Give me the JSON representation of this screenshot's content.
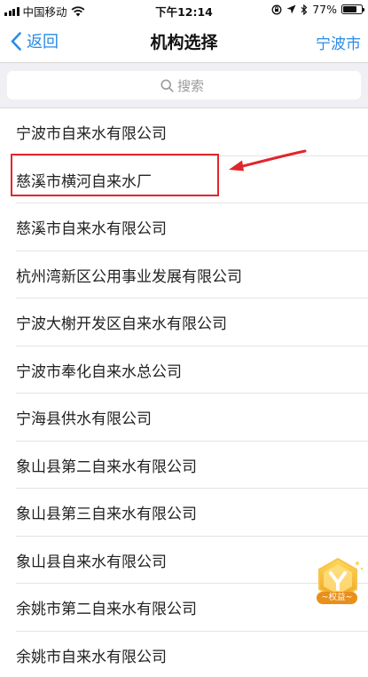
{
  "status_bar": {
    "carrier": "中国移动",
    "time": "下午12:14",
    "battery": "77%",
    "battery_level": 0.77
  },
  "nav": {
    "back_label": "返回",
    "title": "机构选择",
    "city": "宁波市"
  },
  "search": {
    "placeholder": "搜索"
  },
  "organizations": [
    "宁波市自来水有限公司",
    "慈溪市横河自来水厂",
    "慈溪市自来水有限公司",
    "杭州湾新区公用事业发展有限公司",
    "宁波大榭开发区自来水有限公司",
    "宁波市奉化自来水总公司",
    "宁海县供水有限公司",
    "象山县第二自来水有限公司",
    "象山县第三自来水有限公司",
    "象山县自来水有限公司",
    "余姚市第二自来水有限公司",
    "余姚市自来水有限公司"
  ],
  "highlighted_index": 1,
  "badge": {
    "label": "~权益~"
  },
  "colors": {
    "accent": "#2b8be6",
    "highlight": "#e0262d",
    "search_bg": "#efeff4",
    "badge_gold": "#f2b52a"
  }
}
